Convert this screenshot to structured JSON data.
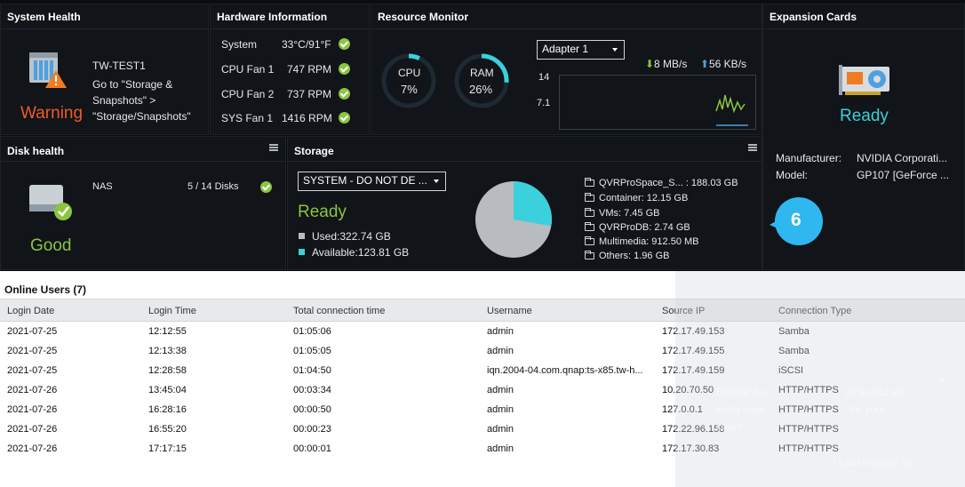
{
  "system_health": {
    "title": "System Health",
    "device_name": "TW-TEST1",
    "message": "Go to \"Storage & Snapshots\" > \"Storage/Snapshots\"",
    "message_lines": [
      "Go to \"Storage &",
      "Snapshots\" >",
      "\"Storage/Snapshots\""
    ],
    "status": "Warning",
    "status_color": "#f05a28",
    "icon": "nas-warning-icon"
  },
  "hardware": {
    "title": "Hardware Information",
    "items": [
      {
        "label": "System",
        "value": "33°C/91°F"
      },
      {
        "label": "CPU Fan 1",
        "value": "747 RPM"
      },
      {
        "label": "CPU Fan 2",
        "value": "737 RPM"
      },
      {
        "label": "SYS Fan 1",
        "value": "1416 RPM"
      }
    ]
  },
  "resource_monitor": {
    "title": "Resource Monitor",
    "cpu": {
      "label": "CPU",
      "value": "7%",
      "percent": 7
    },
    "ram": {
      "label": "RAM",
      "value": "26%",
      "percent": 26
    },
    "adapter": "Adapter 1",
    "download": "8 MB/s",
    "upload": "56 KB/s",
    "axis_top": "14",
    "axis_mid": "7.1",
    "accent": "#3ad0dc"
  },
  "expansion": {
    "title": "Expansion Cards",
    "status": "Ready",
    "icon": "gpu-card-icon",
    "manufacturer_label": "Manufacturer:",
    "manufacturer_value": "NVIDIA Corporati...",
    "model_label": "Model:",
    "model_value": "GP107 [GeForce ..."
  },
  "disk_health": {
    "title": "Disk health",
    "name": "NAS",
    "disks": "5 / 14 Disks",
    "status": "Good",
    "status_color": "#8bc53f"
  },
  "storage": {
    "title": "Storage",
    "pool": "SYSTEM - DO NOT DE ...",
    "status": "Ready",
    "used": "Used:322.74 GB",
    "available": "Available:123.81 GB",
    "used_fraction": 0.723,
    "folders": [
      "QVRProSpace_S... : 188.03 GB",
      "Container: 12.15 GB",
      "VMs: 7.45 GB",
      "QVRProDB: 2.74 GB",
      "Multimedia: 912.50 MB",
      "Others: 1.96 GB"
    ]
  },
  "badge": "6",
  "online_users": {
    "title": "Online Users (7)",
    "columns": [
      "Login Date",
      "Login Time",
      "Total connection time",
      "Username",
      "Source IP",
      "Connection Type"
    ],
    "rows": [
      [
        "2021-07-25",
        "12:12:55",
        "01:05:06",
        "admin",
        "172.17.49.153",
        "Samba"
      ],
      [
        "2021-07-25",
        "12:13:38",
        "01:05:05",
        "admin",
        "172.17.49.155",
        "Samba"
      ],
      [
        "2021-07-25",
        "12:28:58",
        "01:04:50",
        "iqn.2004-04.com.qnap:ts-x85.tw-h...",
        "172.17.49.159",
        "iSCSI"
      ],
      [
        "2021-07-26",
        "13:45:04",
        "00:03:34",
        "admin",
        "10.20.70.50",
        "HTTP/HTTPS"
      ],
      [
        "2021-07-26",
        "16:28:16",
        "00:00:50",
        "admin",
        "127.0.0.1",
        "HTTP/HTTPS"
      ],
      [
        "2021-07-26",
        "16:55:20",
        "00:00:23",
        "admin",
        "172.22.96.158",
        "HTTP/HTTPS"
      ],
      [
        "2021-07-26",
        "17:17:15",
        "00:00:01",
        "admin",
        "172.17.30.83",
        "HTTP/HTTPS"
      ]
    ]
  },
  "notice_overlay": {
    "line1": "Enable 2-s",
    "line2": "on to add an",
    "line3": "extra layer",
    "line4": "for your",
    "line5": "count.",
    "total": "(Total notices: 5)"
  }
}
